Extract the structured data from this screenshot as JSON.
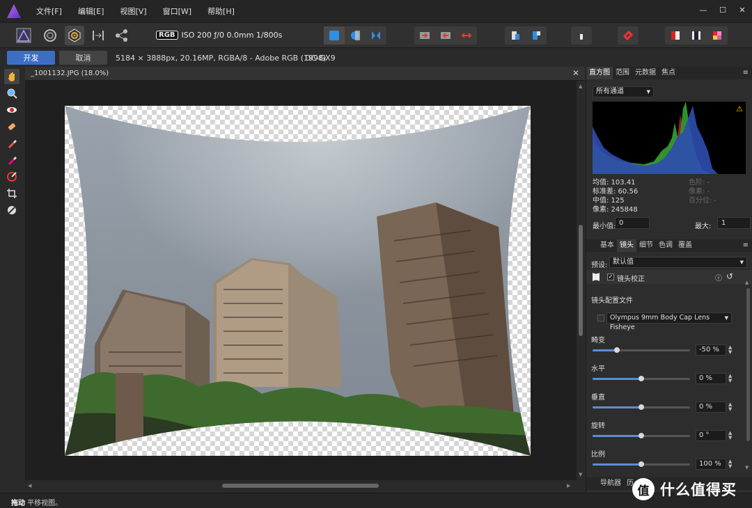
{
  "menu": [
    "文件[F]",
    "编辑[E]",
    "视图[V]",
    "窗口[W]",
    "帮助[H]"
  ],
  "window_controls": [
    "—",
    "☐",
    "✕"
  ],
  "toolbar": {
    "color_badge": "RGB",
    "exif": "ISO 200 ƒ/0 0.0mm 1/800s"
  },
  "context": {
    "develop_label": "开发",
    "cancel_label": "取消",
    "image_info": "5184 × 3888px, 20.16MP, RGBA/8 - Adobe RGB (1998)",
    "camera": "DC-GX9"
  },
  "document": {
    "title": "_1001132.JPG (18.0%)",
    "close": "✕"
  },
  "histogram_panel": {
    "tabs": [
      "直方图",
      "范围",
      "元数据",
      "焦点"
    ],
    "channel": "所有通道",
    "stats": [
      "均值: 103.41",
      "标准差: 60.56",
      "中值: 125",
      "像素: 245848"
    ],
    "stats_dim": [
      "色阶: -",
      "像素: -",
      "百分位: -"
    ],
    "min_label": "最小值:",
    "min_value": "0",
    "max_label": "最大:",
    "max_value": "1"
  },
  "develop_panel": {
    "tabs": [
      "基本",
      "镜头",
      "细节",
      "色调",
      "覆盖"
    ],
    "preset_label": "预设:",
    "preset_value": "默认值",
    "section_title": "镜头校正",
    "profile_label": "镜头配置文件",
    "profile_value": "Olympus 9mm Body Cap Lens Fisheye",
    "sliders": [
      {
        "label": "畸变",
        "value": "-50 %",
        "fraction": 0.25
      },
      {
        "label": "水平",
        "value": "0 %",
        "fraction": 0.5
      },
      {
        "label": "垂直",
        "value": "0 %",
        "fraction": 0.5
      },
      {
        "label": "旋转",
        "value": "0 °",
        "fraction": 0.5
      },
      {
        "label": "比例",
        "value": "100 %",
        "fraction": 0.5
      }
    ]
  },
  "bottom_tabs": [
    "导航器",
    "历"
  ],
  "status": {
    "bold": "拖动",
    "text": " 平移视图。"
  },
  "watermark": {
    "badge": "值",
    "text": "什么值得买"
  }
}
